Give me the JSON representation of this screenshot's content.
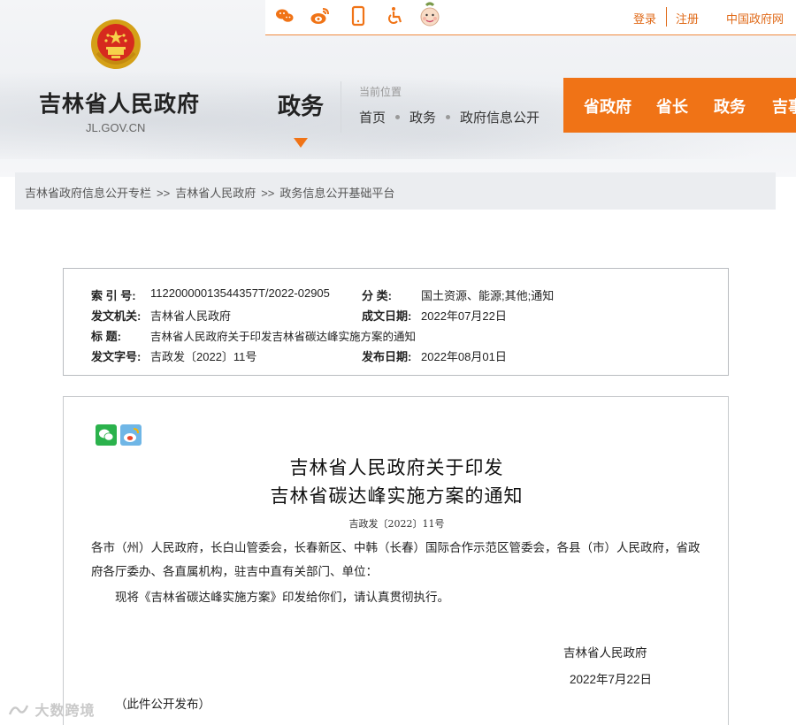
{
  "topbar": {
    "icons": [
      "weibo-like-icon",
      "weibo-icon",
      "mobile-icon",
      "accessibility-icon",
      "elder-mode-icon"
    ],
    "login": "登录",
    "register": "注册",
    "china_gov": "中国政府网"
  },
  "site": {
    "name": "吉林省人民政府",
    "domain": "JL.GOV.CN"
  },
  "section": {
    "name": "政务"
  },
  "location": {
    "label": "当前位置",
    "items": [
      "首页",
      "政务",
      "政府信息公开"
    ]
  },
  "mainnav": {
    "items": [
      "省政府",
      "省长",
      "政务",
      "吉事"
    ]
  },
  "breadcrumb": {
    "items": [
      "吉林省政府信息公开专栏",
      "吉林省人民政府",
      "政务信息公开基础平台"
    ],
    "sep": ">>"
  },
  "info": {
    "index_label": "索 引 号:",
    "index_value": "11220000013544357T/2022-02905",
    "category_label": "分    类:",
    "category_value": "国土资源、能源;其他;通知",
    "issuer_label": "发文机关:",
    "issuer_value": "吉林省人民政府",
    "date_created_label": "成文日期:",
    "date_created_value": "2022年07月22日",
    "title_label": "标    题:",
    "title_value": "吉林省人民政府关于印发吉林省碳达峰实施方案的通知",
    "docno_label": "发文字号:",
    "docno_value": "吉政发〔2022〕11号",
    "date_published_label": "发布日期:",
    "date_published_value": "2022年08月01日"
  },
  "article": {
    "title_line1": "吉林省人民政府关于印发",
    "title_line2": "吉林省碳达峰实施方案的通知",
    "doc_no": "吉政发〔2022〕11号",
    "recipients_line1": "各市（州）人民政府，长白山管委会，长春新区、中韩（长春）国际合作示范区管委会，各县（市）人民政府，省政",
    "recipients_line2": "府各厅委办、各直属机构，驻吉中直有关部门、单位：",
    "body": "现将《吉林省碳达峰实施方案》印发给你们，请认真贯彻执行。",
    "signer": "吉林省人民政府",
    "sign_date": "2022年7月22日",
    "public_note": "（此件公开发布）"
  },
  "watermark": "大数跨境",
  "colors": {
    "accent": "#f07316",
    "toplink": "#e06a18"
  }
}
